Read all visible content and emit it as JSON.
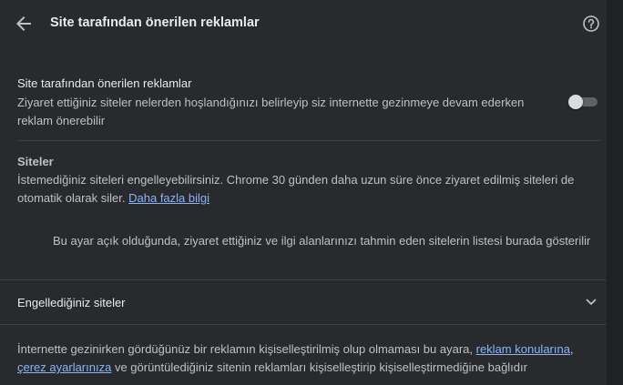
{
  "header": {
    "title": "Site tarafından önerilen reklamlar",
    "back_icon": "arrow-left-icon",
    "help_icon": "help-circle-icon"
  },
  "setting": {
    "title": "Site tarafından önerilen reklamlar",
    "description": "Ziyaret ettiğiniz siteler nelerden hoşlandığınızı belirleyip siz internette gezinmeye devam ederken reklam önerebilir",
    "toggle_state": "off"
  },
  "sites": {
    "heading": "Siteler",
    "description": "İstemediğiniz siteleri engelleyebilirsiniz. Chrome 30 günden daha uzun süre önce ziyaret edilmiş siteleri de otomatik olarak siler.",
    "learn_more_link": "Daha fazla bilgi",
    "empty_message": "Bu ayar açık olduğunda, ziyaret ettiğiniz ve ilgi alanlarınızı tahmin eden sitelerin listesi burada gösterilir"
  },
  "blocked": {
    "label": "Engellediğiniz siteler",
    "chevron_icon": "chevron-down-icon"
  },
  "footer": {
    "text_part1": "İnternette gezinirken gördüğünüz bir reklamın kişiselleştirilmiş olup olmaması bu ayara, ",
    "link1": "reklam konularına",
    "text_part2": ", ",
    "link2": "çerez ayarlarınıza",
    "text_part3": " ve görüntülediğiniz sitenin reklamları kişiselleştirip kişiselleştirmediğine bağlıdır"
  },
  "colors": {
    "background": "#292a2d",
    "link": "#8ab4f8",
    "text": "#e8eaed",
    "secondary_text": "#bdc1c6"
  }
}
